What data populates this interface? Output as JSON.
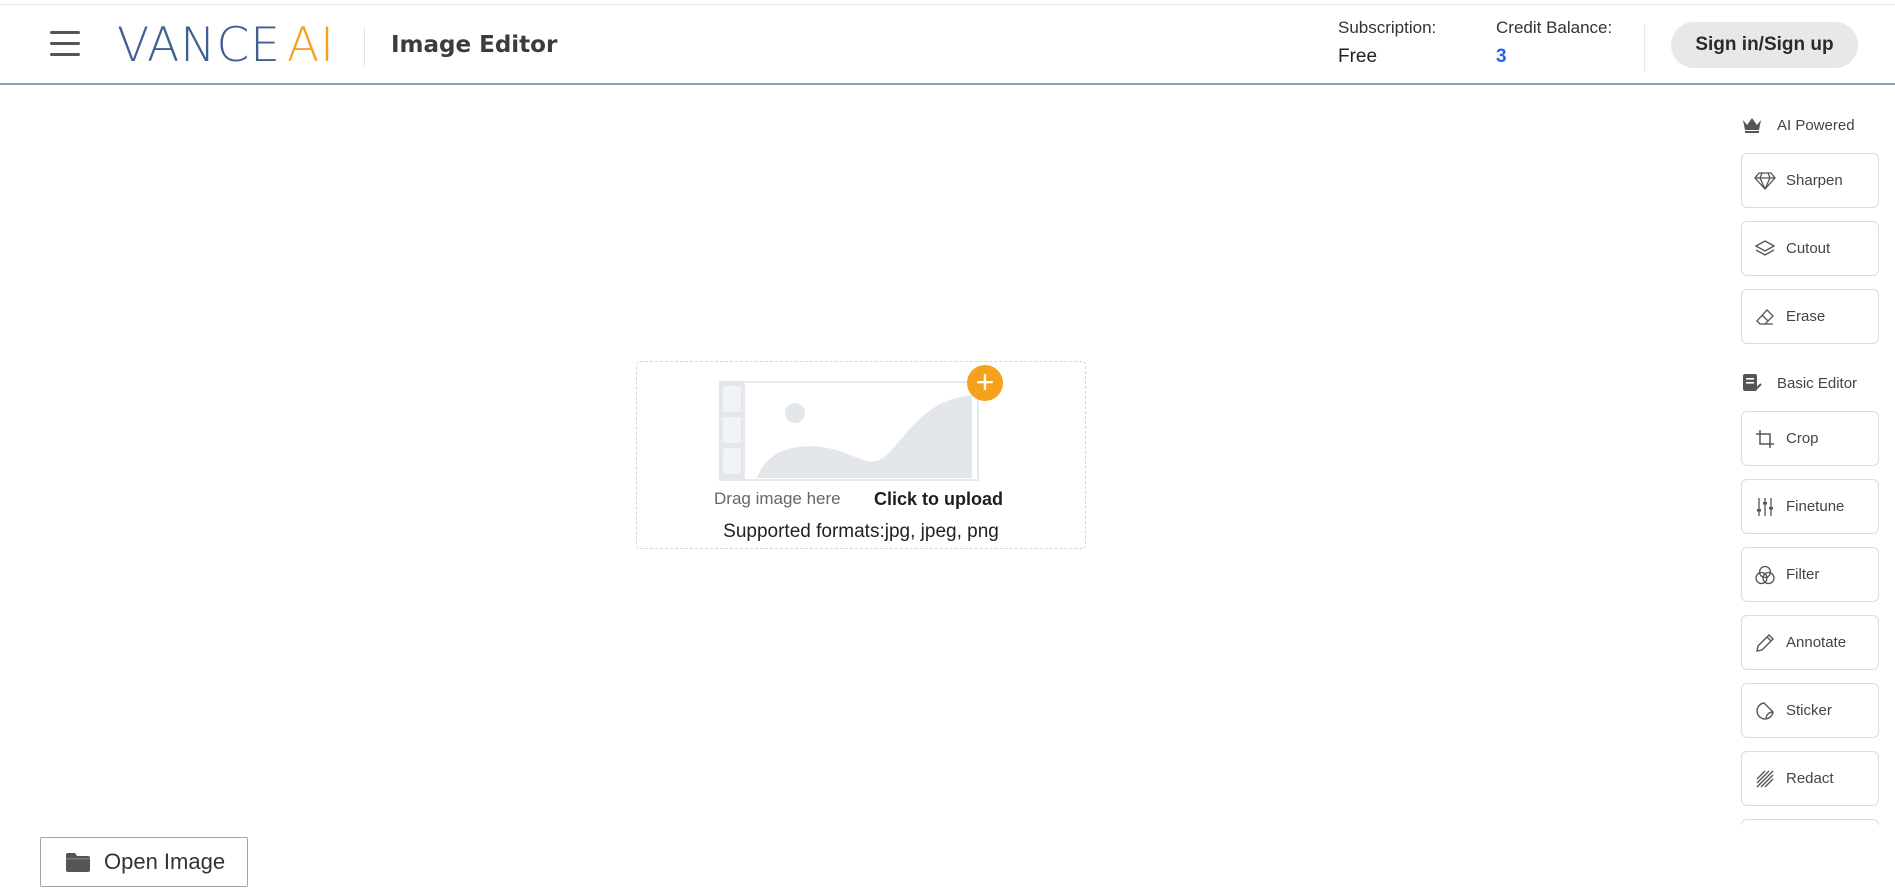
{
  "header": {
    "logo_main": "VANCE",
    "logo_accent": "AI",
    "title": "Image Editor",
    "subscription_label": "Subscription:",
    "subscription_value": "Free",
    "credit_label": "Credit Balance:",
    "credit_value": "3",
    "signin_label": "Sign in/Sign up",
    "icons": [
      "menu-icon"
    ]
  },
  "upload": {
    "drag_text": "Drag image here",
    "click_text": "Click to upload",
    "formats_text": "Supported formats:jpg, jpeg, png",
    "add_symbol": "+",
    "accent_color": "#f5a11d"
  },
  "panel": {
    "ai_section": {
      "label": "AI Powered",
      "icon": "crown-icon",
      "tools": [
        {
          "label": "Sharpen",
          "icon": "diamond-icon"
        },
        {
          "label": "Cutout",
          "icon": "layers-icon"
        },
        {
          "label": "Erase",
          "icon": "eraser-icon"
        }
      ]
    },
    "basic_section": {
      "label": "Basic Editor",
      "icon": "note-edit-icon",
      "tools": [
        {
          "label": "Crop",
          "icon": "crop-icon"
        },
        {
          "label": "Finetune",
          "icon": "sliders-icon"
        },
        {
          "label": "Filter",
          "icon": "filter-circles-icon"
        },
        {
          "label": "Annotate",
          "icon": "pencil-icon"
        },
        {
          "label": "Sticker",
          "icon": "sticker-icon"
        },
        {
          "label": "Redact",
          "icon": "redact-icon"
        }
      ]
    }
  },
  "footer": {
    "open_label": "Open Image",
    "open_icon": "folder-icon"
  },
  "colors": {
    "brand_blue": "#3e5f91",
    "brand_orange": "#f5a11d",
    "credit_blue": "#2563eb"
  }
}
